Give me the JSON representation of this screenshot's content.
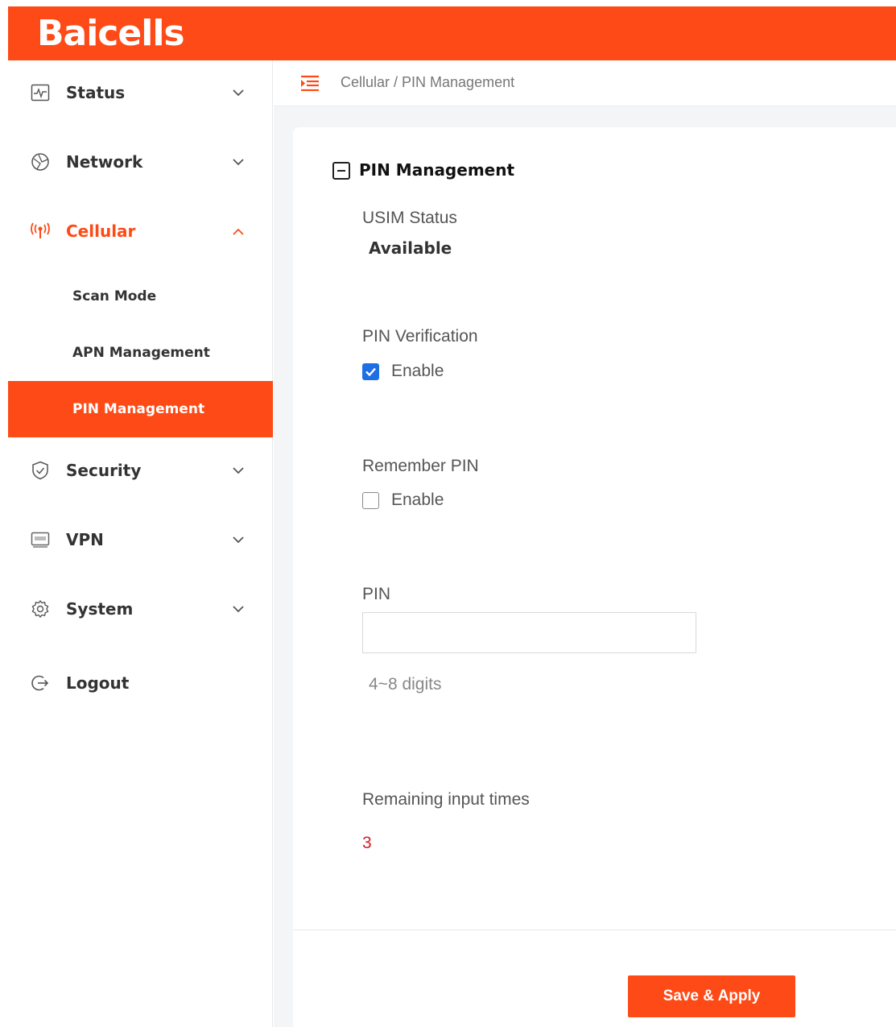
{
  "brand": {
    "logo_text": "Baicells",
    "accent": "#fe4a17"
  },
  "sidebar": {
    "items": [
      {
        "label": "Status",
        "icon": "activity-monitor-icon",
        "expanded": false
      },
      {
        "label": "Network",
        "icon": "globe-icon",
        "expanded": false
      },
      {
        "label": "Cellular",
        "icon": "antenna-signal-icon",
        "expanded": true,
        "children": [
          {
            "label": "Scan Mode"
          },
          {
            "label": "APN Management"
          },
          {
            "label": "PIN Management",
            "active": true
          }
        ]
      },
      {
        "label": "Security",
        "icon": "shield-check-icon",
        "expanded": false
      },
      {
        "label": "VPN",
        "icon": "vpn-icon",
        "expanded": false
      },
      {
        "label": "System",
        "icon": "gear-icon",
        "expanded": false
      },
      {
        "label": "Logout",
        "icon": "logout-icon"
      }
    ]
  },
  "breadcrumb": "Cellular / PIN Management",
  "section": {
    "title": "PIN Management",
    "usim_status_label": "USIM Status",
    "usim_status_value": "Available",
    "pin_verification_label": "PIN Verification",
    "pin_verification_option": "Enable",
    "pin_verification_checked": true,
    "remember_pin_label": "Remember PIN",
    "remember_pin_option": "Enable",
    "remember_pin_checked": false,
    "pin_label": "PIN",
    "pin_value": "",
    "pin_hint": "4~8 digits",
    "remaining_label": "Remaining input times",
    "remaining_value": "3"
  },
  "actions": {
    "save_label": "Save & Apply"
  },
  "colors": {
    "accent": "#fe4a17",
    "checkbox": "#1e6fe6",
    "remaining": "#d0202a"
  }
}
